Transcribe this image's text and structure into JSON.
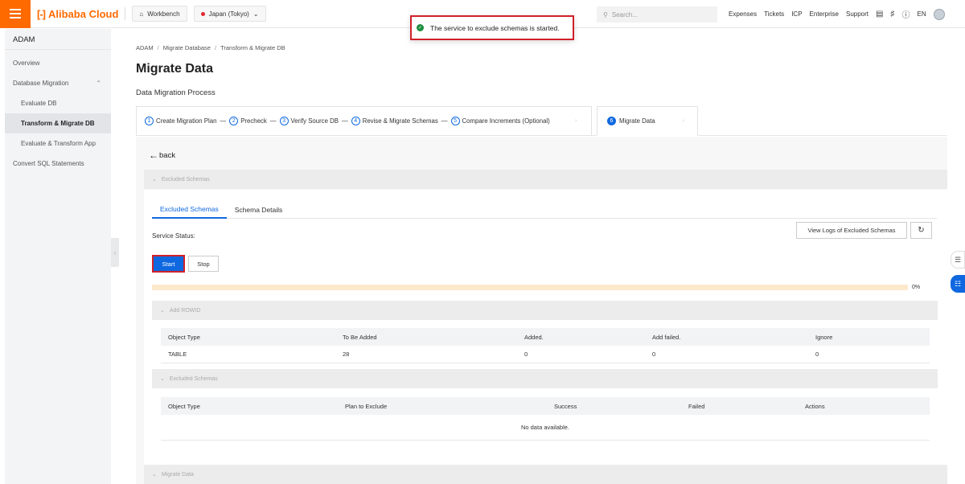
{
  "topbar": {
    "brand": "Alibaba Cloud",
    "workbench": "Workbench",
    "region": "Japan (Tokyo)",
    "search_placeholder": "Search...",
    "links": [
      "Expenses",
      "Tickets",
      "ICP",
      "Enterprise",
      "Support"
    ],
    "language": "EN"
  },
  "toast": {
    "message": "The service to exclude schemas is started."
  },
  "sidebar": {
    "title": "ADAM",
    "items": [
      {
        "label": "Overview"
      },
      {
        "label": "Database Migration"
      },
      {
        "label": "Evaluate DB"
      },
      {
        "label": "Transform & Migrate DB"
      },
      {
        "label": "Evaluate & Transform App"
      },
      {
        "label": "Convert SQL Statements"
      }
    ]
  },
  "breadcrumb": [
    "ADAM",
    "Migrate Database",
    "Transform & Migrate DB"
  ],
  "page_title": "Migrate Data",
  "sub_title": "Data Migration Process",
  "steps": [
    {
      "num": "1",
      "label": "Create Migration Plan"
    },
    {
      "num": "2",
      "label": "Precheck"
    },
    {
      "num": "3",
      "label": "Verify Source DB"
    },
    {
      "num": "4",
      "label": "Revise & Migrate Schemas"
    },
    {
      "num": "5",
      "label": "Compare Increments (Optional)"
    },
    {
      "num": "6",
      "label": "Migrate Data"
    }
  ],
  "back_label": "back",
  "sections": {
    "excluded_top": "Excluded Schemas",
    "add_rowid": "Add ROWID",
    "excluded_schemas": "Excluded Schemas",
    "migrate_data": "Migrate Data"
  },
  "tabs": [
    "Excluded Schemas",
    "Schema Details"
  ],
  "service_status_label": "Service Status:",
  "buttons": {
    "view_logs": "View Logs of Excluded Schemas",
    "start": "Start",
    "stop": "Stop"
  },
  "progress": {
    "label": "0%",
    "value": 0
  },
  "rowid_table": {
    "headers": [
      "Object Type",
      "To Be Added",
      "Added.",
      "Add failed.",
      "Ignore"
    ],
    "rows": [
      [
        "TABLE",
        "28",
        "0",
        "0",
        "0"
      ]
    ]
  },
  "excluded_table": {
    "headers": [
      "Object Type",
      "Plan to Exclude",
      "Success",
      "Failed",
      "Actions"
    ],
    "empty_text": "No data available."
  },
  "colors": {
    "accent": "#1068e0",
    "brand": "#ff6a00",
    "highlight": "#d0212b"
  }
}
